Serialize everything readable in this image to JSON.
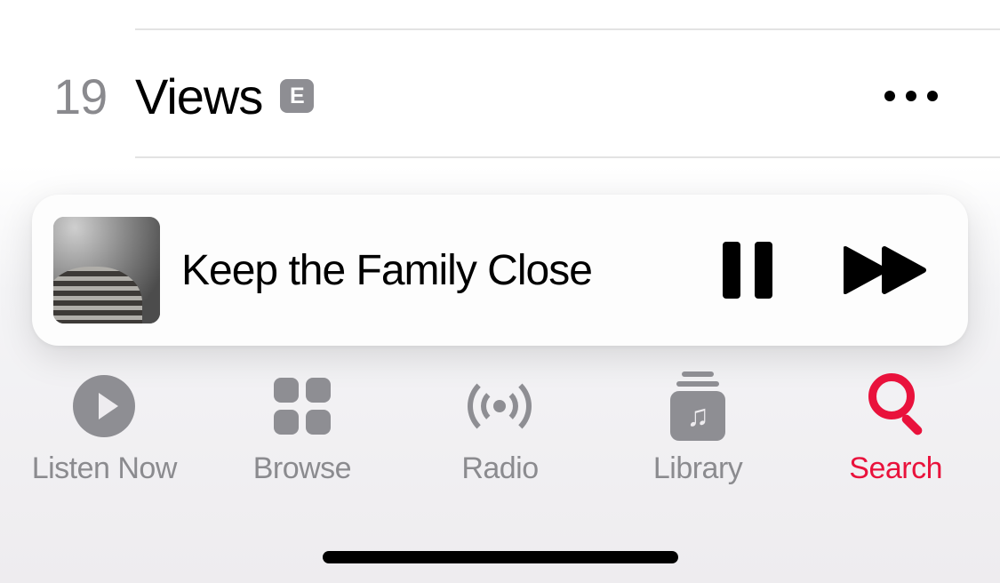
{
  "track": {
    "number": "19",
    "title": "Views",
    "explicit_label": "E"
  },
  "now_playing": {
    "title": "Keep the Family Close"
  },
  "tabs": [
    {
      "id": "listen-now",
      "label": "Listen Now",
      "active": false
    },
    {
      "id": "browse",
      "label": "Browse",
      "active": false
    },
    {
      "id": "radio",
      "label": "Radio",
      "active": false
    },
    {
      "id": "library",
      "label": "Library",
      "active": false
    },
    {
      "id": "search",
      "label": "Search",
      "active": true
    }
  ],
  "colors": {
    "accent": "#e9123c",
    "inactive": "#8e8e93"
  }
}
